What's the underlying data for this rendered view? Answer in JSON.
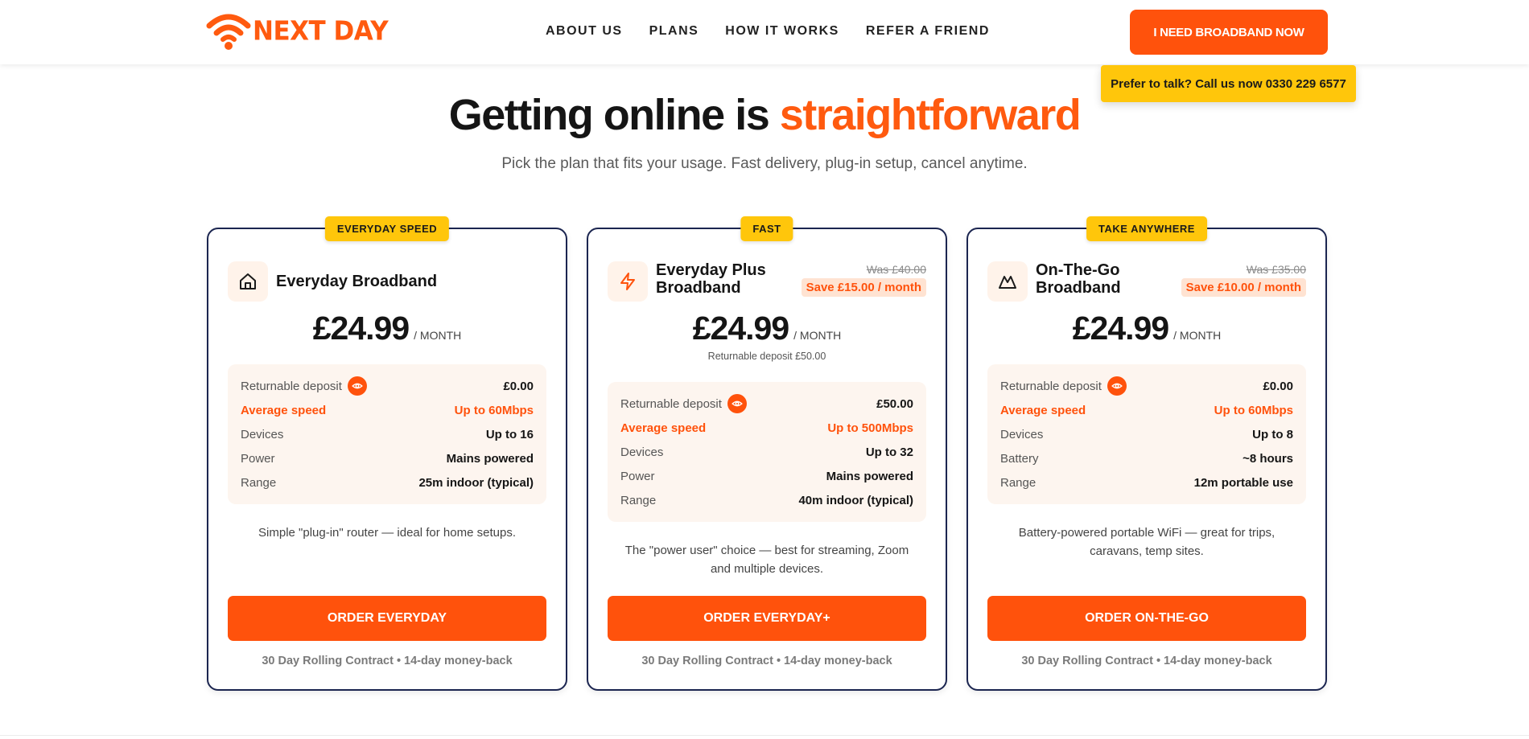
{
  "brand": {
    "logo_text": "NEXT DAY",
    "accent_color": "#ff520c",
    "badge_color": "#ffc60b",
    "card_border_color": "#1b2550"
  },
  "header": {
    "nav": [
      "ABOUT US",
      "PLANS",
      "HOW IT WORKS",
      "REFER A FRIEND"
    ],
    "cta_label": "I NEED BROADBAND NOW",
    "call_text": "Prefer to talk? Call us now 0330 229 6577"
  },
  "hero": {
    "title_main": "Getting online is ",
    "title_accent": "straightforward",
    "subtitle": "Pick the plan that fits your usage. Fast delivery, plug-in setup, cancel anytime."
  },
  "plans": [
    {
      "badge": "EVERYDAY SPEED",
      "icon": "home-icon",
      "name": "Everyday Broadband",
      "price": "£24.99",
      "per": "/ MONTH",
      "specs": [
        {
          "label": "Returnable deposit",
          "value": "£0.00",
          "info_icon": "eye-icon"
        },
        {
          "label": "Average speed",
          "value": "Up to 60Mbps"
        },
        {
          "label": "Devices",
          "value": "Up to 16"
        },
        {
          "label": "Power",
          "value": "Mains powered"
        },
        {
          "label": "Range",
          "value": "25m indoor (typical)"
        }
      ],
      "description": "Simple \"plug-in\" router — ideal for home setups.",
      "button": "ORDER EVERYDAY",
      "footnote": "30 Day Rolling Contract • 14-day money-back"
    },
    {
      "badge": "FAST",
      "icon": "lightning-icon",
      "name": "Everyday Plus Broadband",
      "was": "Was £40.00",
      "save": "Save £15.00 / month",
      "price": "£24.99",
      "per": "/ MONTH",
      "deposit_note": "Returnable deposit £50.00",
      "specs": [
        {
          "label": "Returnable deposit",
          "value": "£50.00",
          "info_icon": "eye-icon"
        },
        {
          "label": "Average speed",
          "value": "Up to 500Mbps"
        },
        {
          "label": "Devices",
          "value": "Up to 32"
        },
        {
          "label": "Power",
          "value": "Mains powered"
        },
        {
          "label": "Range",
          "value": "40m indoor (typical)"
        }
      ],
      "description": "The \"power user\" choice — best for streaming, Zoom and multiple devices.",
      "button": "ORDER EVERYDAY+",
      "footnote": "30 Day Rolling Contract • 14-day money-back"
    },
    {
      "badge": "TAKE ANYWHERE",
      "icon": "mountain-icon",
      "name": "On-The-Go Broadband",
      "was": "Was £35.00",
      "save": "Save £10.00 / month",
      "price": "£24.99",
      "per": "/ MONTH",
      "specs": [
        {
          "label": "Returnable deposit",
          "value": "£0.00",
          "info_icon": "eye-icon"
        },
        {
          "label": "Average speed",
          "value": "Up to 60Mbps"
        },
        {
          "label": "Devices",
          "value": "Up to 8"
        },
        {
          "label": "Battery",
          "value": "~8 hours"
        },
        {
          "label": "Range",
          "value": "12m portable use"
        }
      ],
      "description": "Battery-powered portable WiFi — great for trips, caravans, temp sites.",
      "button": "ORDER ON-THE-GO",
      "footnote": "30 Day Rolling Contract • 14-day money-back"
    }
  ]
}
